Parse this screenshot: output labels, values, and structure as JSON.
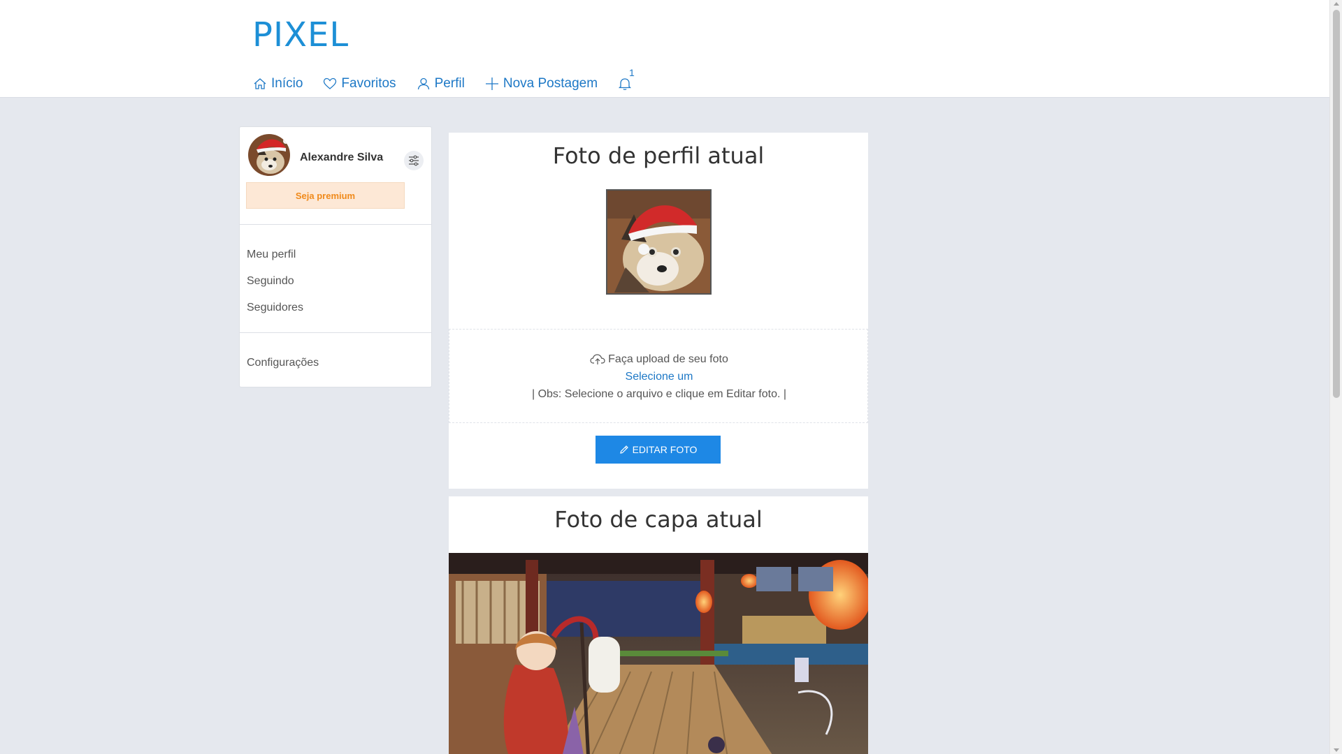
{
  "brand": {
    "name": "PIXEL"
  },
  "nav": {
    "items": [
      {
        "label": "Início",
        "icon": "home-icon"
      },
      {
        "label": "Favoritos",
        "icon": "heart-icon"
      },
      {
        "label": "Perfil",
        "icon": "user-icon"
      },
      {
        "label": "Nova Postagem",
        "icon": "plus-icon"
      }
    ],
    "notifications": {
      "icon": "bell-icon",
      "count": "1"
    }
  },
  "sidebar": {
    "user_name": "Alexandre Silva",
    "avatar_icon": "avatar-dog-santa-hat",
    "filter_icon": "sliders-icon",
    "premium_label": "Seja premium",
    "links": [
      "Meu perfil",
      "Seguindo",
      "Seguidores"
    ],
    "settings_label": "Configurações"
  },
  "profile_panel": {
    "title": "Foto de perfil atual",
    "upload_text": "Faça upload de seu foto",
    "upload_icon": "cloud-upload-icon",
    "select_label": "Selecione um",
    "note": "| Obs: Selecione o arquivo e clique em Editar foto. |",
    "edit_button": "EDITAR FOTO",
    "edit_icon": "pencil-icon"
  },
  "cover_panel": {
    "title": "Foto de capa atual"
  },
  "colors": {
    "brand": "#1d8fd6",
    "link": "#1d78c6",
    "page_bg": "#e5e8ee",
    "button": "#1e88e5",
    "premium_bg": "#fde8d6",
    "premium_text": "#f08a1b"
  }
}
